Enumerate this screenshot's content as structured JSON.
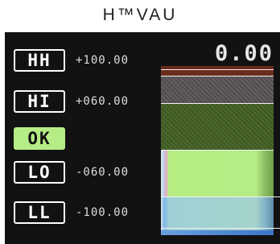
{
  "title": "H™VAU",
  "readout": "0.00",
  "levels": [
    {
      "label": "HH",
      "limit": "+100.00",
      "active": false
    },
    {
      "label": "HI",
      "limit": "+060.00",
      "active": false
    },
    {
      "label": "OK",
      "limit": "",
      "active": true
    },
    {
      "label": "LO",
      "limit": "-060.00",
      "active": false
    },
    {
      "label": "LL",
      "limit": "-100.00",
      "active": false
    }
  ],
  "colors": {
    "ok_active": "#b5ec86",
    "panel_bg": "#121212",
    "hh_zone": "#6a2c1c",
    "hi_zone": "#5c545a",
    "ok_zone": "#4a6a2c",
    "lo_zone": "#b5ec86",
    "ll_zone": "#a5d3cb"
  }
}
